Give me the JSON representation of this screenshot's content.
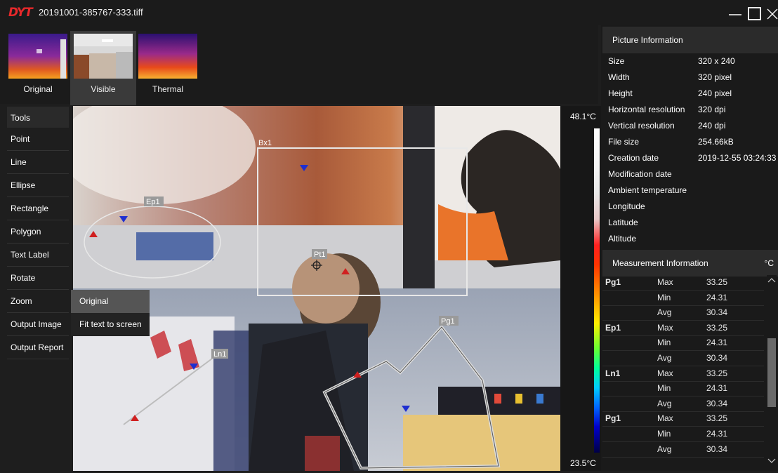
{
  "window": {
    "logo": "DYT",
    "title": "20191001-385767-333.tiff"
  },
  "thumbnails": [
    {
      "label": "Original"
    },
    {
      "label": "Visible"
    },
    {
      "label": "Thermal"
    }
  ],
  "tools": {
    "header": "Tools",
    "items": [
      "Point",
      "Line",
      "Ellipse",
      "Rectangle",
      "Polygon",
      "Text Label",
      "Rotate",
      "Zoom",
      "Output Image",
      "Output Report"
    ]
  },
  "zoom_menu": {
    "items": [
      "Original",
      "Fit text to screen"
    ]
  },
  "image": {
    "annotations": {
      "box": "Bx1",
      "ellipse": "Ep1",
      "point": "Pt1",
      "line": "Ln1",
      "polygon": "Pg1"
    }
  },
  "colorbar": {
    "max_label": "48.1°C",
    "min_label": "23.5°C"
  },
  "picture_info": {
    "header": "Picture Information",
    "rows": [
      {
        "label": "Size",
        "value": "320 x 240"
      },
      {
        "label": "Width",
        "value": "320 pixel"
      },
      {
        "label": "Height",
        "value": "240 pixel"
      },
      {
        "label": "Horizontal resolution",
        "value": "320 dpi"
      },
      {
        "label": "Vertical resolution",
        "value": "240 dpi"
      },
      {
        "label": "File size",
        "value": "254.66kB"
      },
      {
        "label": "Creation date",
        "value": "2019-12-55 03:24:33"
      },
      {
        "label": "Modification date",
        "value": ""
      },
      {
        "label": "Ambient temperature",
        "value": ""
      },
      {
        "label": "Longitude",
        "value": ""
      },
      {
        "label": "Latitude",
        "value": ""
      },
      {
        "label": "Altitude",
        "value": ""
      }
    ]
  },
  "measurement_info": {
    "header": "Measurement Information",
    "unit": "°C",
    "rows": [
      {
        "name": "Pg1",
        "key": "Max",
        "value": "33.25"
      },
      {
        "name": "",
        "key": "Min",
        "value": "24.31"
      },
      {
        "name": "",
        "key": "Avg",
        "value": "30.34"
      },
      {
        "name": "Ep1",
        "key": "Max",
        "value": "33.25"
      },
      {
        "name": "",
        "key": "Min",
        "value": "24.31"
      },
      {
        "name": "",
        "key": "Avg",
        "value": "30.34"
      },
      {
        "name": "Ln1",
        "key": "Max",
        "value": "33.25"
      },
      {
        "name": "",
        "key": "Min",
        "value": "24.31"
      },
      {
        "name": "",
        "key": "Avg",
        "value": "30.34"
      },
      {
        "name": "Pg1",
        "key": "Max",
        "value": "33.25"
      },
      {
        "name": "",
        "key": "Min",
        "value": "24.31"
      },
      {
        "name": "",
        "key": "Avg",
        "value": "30.34"
      }
    ]
  }
}
